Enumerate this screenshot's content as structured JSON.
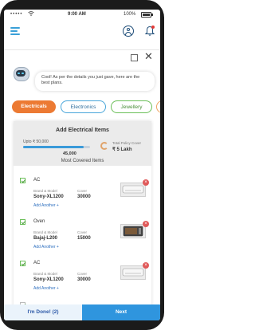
{
  "status_bar": {
    "carrier": "•••••",
    "time": "9:00 AM",
    "battery": "100%"
  },
  "chat": {
    "message": "Cool! As per the details you just gave, here are the best plans."
  },
  "categories": [
    {
      "label": "Electricals",
      "active": true
    },
    {
      "label": "Electronics",
      "active": false
    },
    {
      "label": "Jewellery",
      "active": false
    }
  ],
  "panel": {
    "title": "Add Electrical Items",
    "upto_label": "Upto ₹ 50,000",
    "slider_fraction": 0.9,
    "slider_value": "45,000",
    "total_cover_label": "Total Policy Cover",
    "total_cover_value": "₹ 5 Lakh",
    "section_title": "Most Covered Items"
  },
  "items": [
    {
      "name": "AC",
      "brand_label": "Brand & Model",
      "model": "Sony-XL1200",
      "cover_label": "Cover",
      "cover": "30000",
      "add_label": "Add Another +"
    },
    {
      "name": "Oven",
      "brand_label": "Brand & Model",
      "model": "Bajaj-L200",
      "cover_label": "Cover",
      "cover": "15000",
      "add_label": "Add Another +"
    },
    {
      "name": "AC",
      "brand_label": "Brand & Model",
      "model": "Sony-XL1200",
      "cover_label": "Cover",
      "cover": "30000",
      "add_label": "Add Another +"
    }
  ],
  "actions": {
    "done_label": "I'm Done! (2)",
    "next_label": "Next"
  },
  "colors": {
    "accent_orange": "#ec7a33",
    "primary_blue": "#2f95de",
    "check_green": "#6bbf59"
  }
}
